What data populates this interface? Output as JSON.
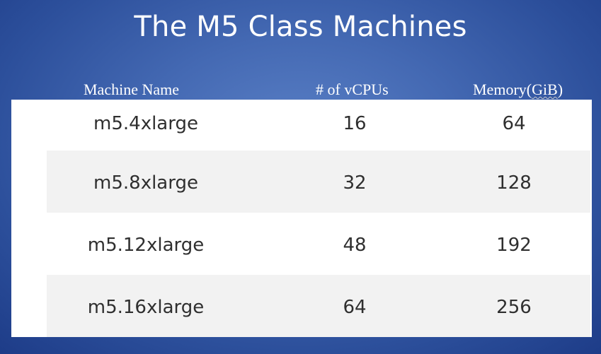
{
  "title": "The M5 Class Machines",
  "table": {
    "headers": [
      "Machine Name",
      "# of vCPUs",
      "Memory(GiB)"
    ],
    "rows": [
      [
        "m5.4xlarge",
        "16",
        "64"
      ],
      [
        "m5.8xlarge",
        "32",
        "128"
      ],
      [
        "m5.12xlarge",
        "48",
        "192"
      ],
      [
        "m5.16xlarge",
        "64",
        "256"
      ]
    ]
  },
  "colors": {
    "background": "#4469b3",
    "title_text": "#ffffff",
    "table_background": "#ffffff",
    "row_stripe": "#f2f2f2",
    "cell_text": "#2f2f2f"
  }
}
